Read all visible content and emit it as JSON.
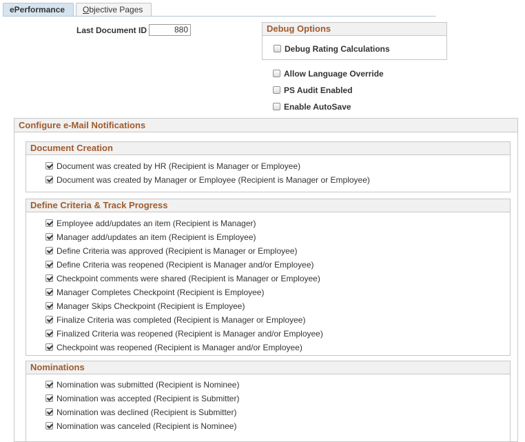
{
  "tabs": [
    {
      "label": "ePerformance",
      "active": true
    },
    {
      "label_accel": "O",
      "label_rest": "bjective Pages",
      "active": false
    }
  ],
  "last_document_id": {
    "label": "Last Document ID",
    "value": "880"
  },
  "debug_options": {
    "title": "Debug Options",
    "debug_rating": {
      "label": "Debug Rating Calculations",
      "checked": false
    }
  },
  "options": {
    "allow_language_override": {
      "label": "Allow Language Override",
      "checked": false
    },
    "ps_audit_enabled": {
      "label": "PS Audit Enabled",
      "checked": false
    },
    "enable_autosave": {
      "label": "Enable AutoSave",
      "checked": false
    }
  },
  "email_notifications": {
    "title": "Configure e-Mail Notifications",
    "document_creation": {
      "title": "Document Creation",
      "items": [
        {
          "label": "Document was created by HR (Recipient is Manager or Employee)",
          "checked": true
        },
        {
          "label": "Document was created by Manager or Employee (Recipient is Manager or Employee)",
          "checked": true
        }
      ]
    },
    "define_criteria": {
      "title": "Define Criteria & Track Progress",
      "items": [
        {
          "label": "Employee add/updates an item (Recipient is Manager)",
          "checked": true
        },
        {
          "label": "Manager add/updates an item (Recipient is Employee)",
          "checked": true
        },
        {
          "label": "Define Criteria was approved (Recipient is Manager or Employee)",
          "checked": true
        },
        {
          "label": "Define Criteria was reopened (Recipient is Manager and/or Employee)",
          "checked": true
        },
        {
          "label": "Checkpoint comments were shared (Recipient is Manager or Employee)",
          "checked": true
        },
        {
          "label": "Manager Completes Checkpoint (Recipient is Employee)",
          "checked": true
        },
        {
          "label": "Manager Skips Checkpoint (Recipient is Employee)",
          "checked": true
        },
        {
          "label": "Finalize Criteria was completed (Recipient is Manager or Employee)",
          "checked": true
        },
        {
          "label": "Finalized Criteria was reopened (Recipient is Manager and/or Employee)",
          "checked": true
        },
        {
          "label": "Checkpoint was reopened (Recipient is Manager and/or Employee)",
          "checked": true
        }
      ]
    },
    "nominations": {
      "title": "Nominations",
      "items": [
        {
          "label": "Nomination was submitted (Recipient is Nominee)",
          "checked": true
        },
        {
          "label": "Nomination was accepted (Recipient is Submitter)",
          "checked": true
        },
        {
          "label": "Nomination was declined (Recipient is Submitter)",
          "checked": true
        },
        {
          "label": "Nomination was canceled (Recipient is Nominee)",
          "checked": true
        }
      ]
    }
  }
}
